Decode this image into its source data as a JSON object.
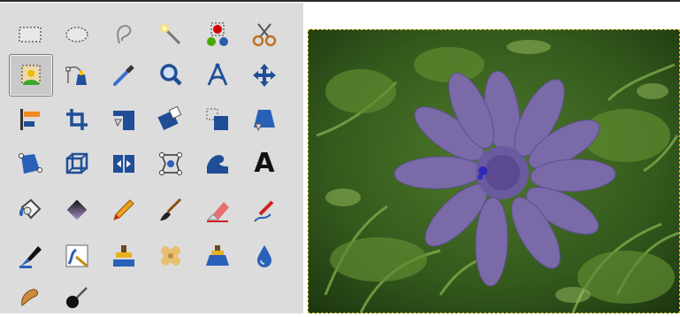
{
  "toolbox": {
    "rows": [
      [
        "rect-select-icon",
        "ellipse-select-icon",
        "free-select-icon",
        "fuzzy-select-icon",
        "color-select-icon",
        "scissors-select-icon"
      ],
      [
        "foreground-select-icon",
        "paths-icon",
        "color-picker-icon",
        "zoom-icon",
        "measure-icon",
        "move-icon"
      ],
      [
        "align-icon",
        "crop-icon",
        "rotate-icon",
        "scale-icon",
        "shear-icon",
        "perspective-icon"
      ],
      [
        "unified-transform-icon",
        "3d-transform-icon",
        "flip-icon",
        "cage-transform-icon",
        "warp-transform-icon",
        "text-icon"
      ],
      [
        "bucket-fill-icon",
        "gradient-icon",
        "pencil-icon",
        "paintbrush-icon",
        "eraser-icon",
        "airbrush-icon"
      ],
      [
        "ink-icon",
        "mypaint-brush-icon",
        "clone-icon",
        "heal-icon",
        "perspective-clone-icon",
        "blur-sharpen-icon"
      ],
      [
        "smudge-icon",
        "dodge-burn-icon"
      ]
    ],
    "active_tool": "foreground-select-icon",
    "text_tool_glyph": "A"
  },
  "canvas": {
    "description_icon": "image-canvas",
    "selection_color": "#7b6aa8"
  }
}
